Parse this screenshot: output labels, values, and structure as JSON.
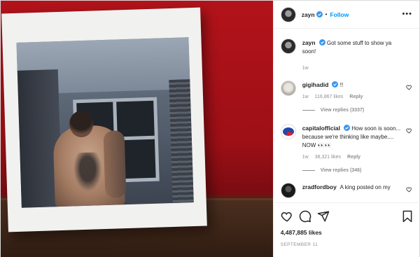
{
  "post": {
    "author": "zayn",
    "follow_label": "Follow",
    "separator": "•",
    "more_label": "•••",
    "likes": "4,487,885 likes",
    "date": "SEPTEMBER 11"
  },
  "caption": {
    "username": "zayn",
    "text": "Got some stuff to show ya soon!",
    "time": "1w"
  },
  "comments": [
    {
      "username": "gigihadid",
      "verified": true,
      "text": "!!",
      "time": "1w",
      "likes": "116,867 likes",
      "reply_label": "Reply",
      "view_replies": "View replies (3337)"
    },
    {
      "username": "capitalofficial",
      "verified": true,
      "text": "How soon is soon... because we're thinking like maybe.... NOW 👀👀",
      "time": "1w",
      "likes": "38,321 likes",
      "reply_label": "Reply",
      "view_replies": "View replies (346)"
    },
    {
      "username": "zradfordboy",
      "verified": false,
      "text": "A king posted on my"
    }
  ],
  "colors": {
    "accent": "#0095f6",
    "verified": "#3897f0",
    "muted": "#8e8e8e"
  },
  "icons": {
    "like": "heart-icon",
    "comment": "comment-icon",
    "share": "paper-plane-icon",
    "save": "bookmark-icon"
  }
}
